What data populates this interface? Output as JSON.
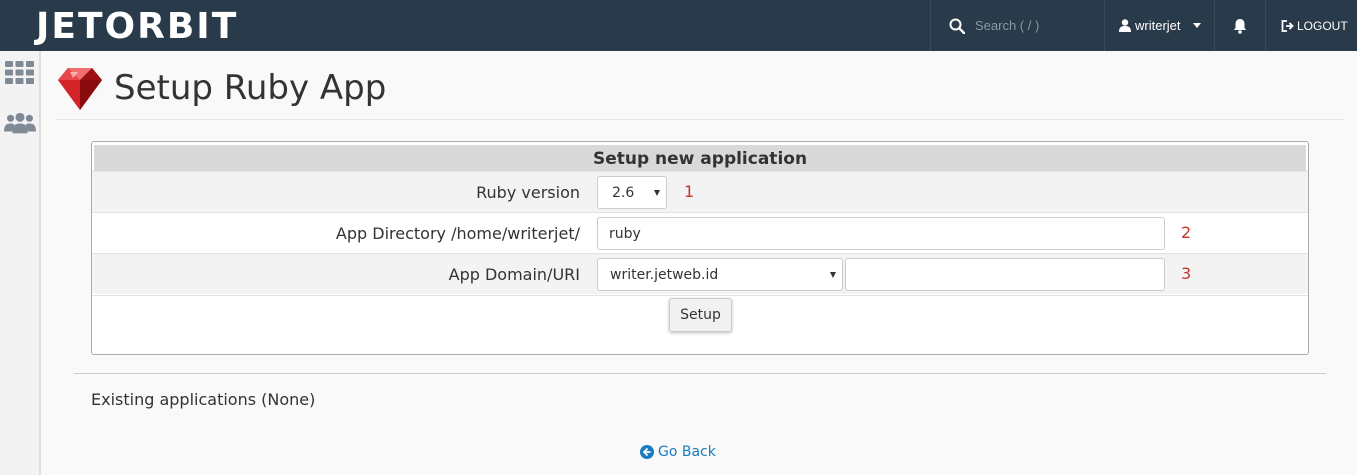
{
  "navbar": {
    "logo_text": "JETORBIT",
    "search_placeholder": "Search ( / )",
    "username": "writerjet",
    "logout_label": "LOGOUT"
  },
  "page": {
    "title": "Setup Ruby App"
  },
  "form": {
    "header": "Setup new application",
    "rows": [
      {
        "label": "Ruby version",
        "value": "2.6",
        "number": "1"
      },
      {
        "label": "App Directory /home/writerjet/",
        "value": "ruby",
        "number": "2"
      },
      {
        "label": "App Domain/URI",
        "value": "writer.jetweb.id",
        "path_value": "",
        "number": "3"
      }
    ],
    "submit_label": "Setup"
  },
  "existing_text": "Existing applications (None)",
  "go_back_label": "Go Back",
  "colors": {
    "navbar": "#293a4a",
    "accent_number": "#c0392b",
    "link": "#1a7bbf",
    "ruby": "#c0171b"
  },
  "icons": [
    "search-icon",
    "user-icon",
    "bell-icon",
    "logout-icon",
    "grid-icon",
    "users-icon",
    "ruby-icon",
    "back-arrow-icon"
  ]
}
